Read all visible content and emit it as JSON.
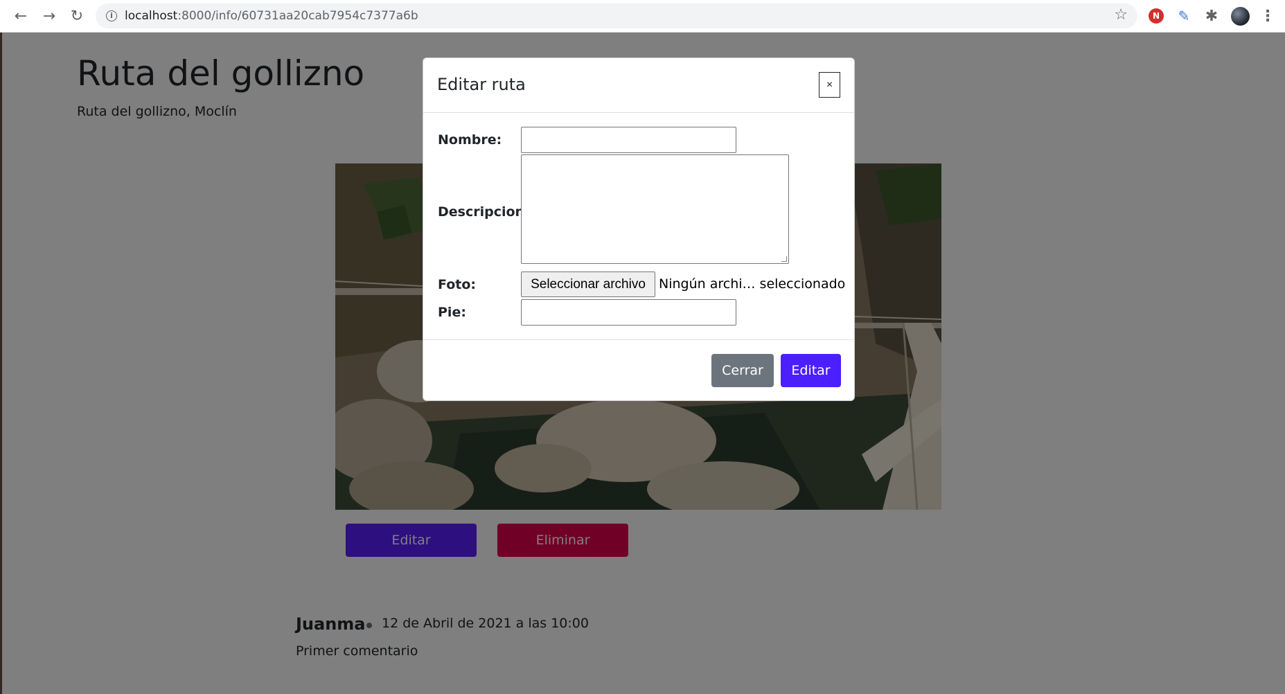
{
  "browser": {
    "url_host": "localhost",
    "url_path": ":8000/info/60731aa20cab7954c7377a6b",
    "back_icon": "←",
    "forward_icon": "→",
    "reload_icon": "↻",
    "info_icon": "i",
    "star_icon": "☆",
    "ext_red_label": "N",
    "feather_icon": "✎",
    "puzzle_icon": "✱",
    "menu_icon": "⋮"
  },
  "page": {
    "title": "Ruta del gollizno",
    "subtitle": "Ruta del gollizno, Moclín",
    "edit_button": "Editar",
    "delete_button": "Eliminar"
  },
  "comment": {
    "author": "Juanma",
    "date": "12 de Abril de 2021 a las 10:00",
    "text": "Primer comentario"
  },
  "modal": {
    "title": "Editar ruta",
    "close_label": "×",
    "fields": {
      "nombre_label": "Nombre:",
      "nombre_value": "",
      "descripcion_label": "Descripcion:",
      "descripcion_value": "",
      "foto_label": "Foto:",
      "file_button": "Seleccionar archivo",
      "file_status": "Ningún archi… seleccionado",
      "pie_label": "Pie:",
      "pie_value": ""
    },
    "cerrar_button": "Cerrar",
    "editar_button": "Editar"
  },
  "colors": {
    "primary": "#5a1eff",
    "danger": "#e0004d",
    "secondary": "#6c757d",
    "backdrop": "rgba(0,0,0,0.5)"
  }
}
